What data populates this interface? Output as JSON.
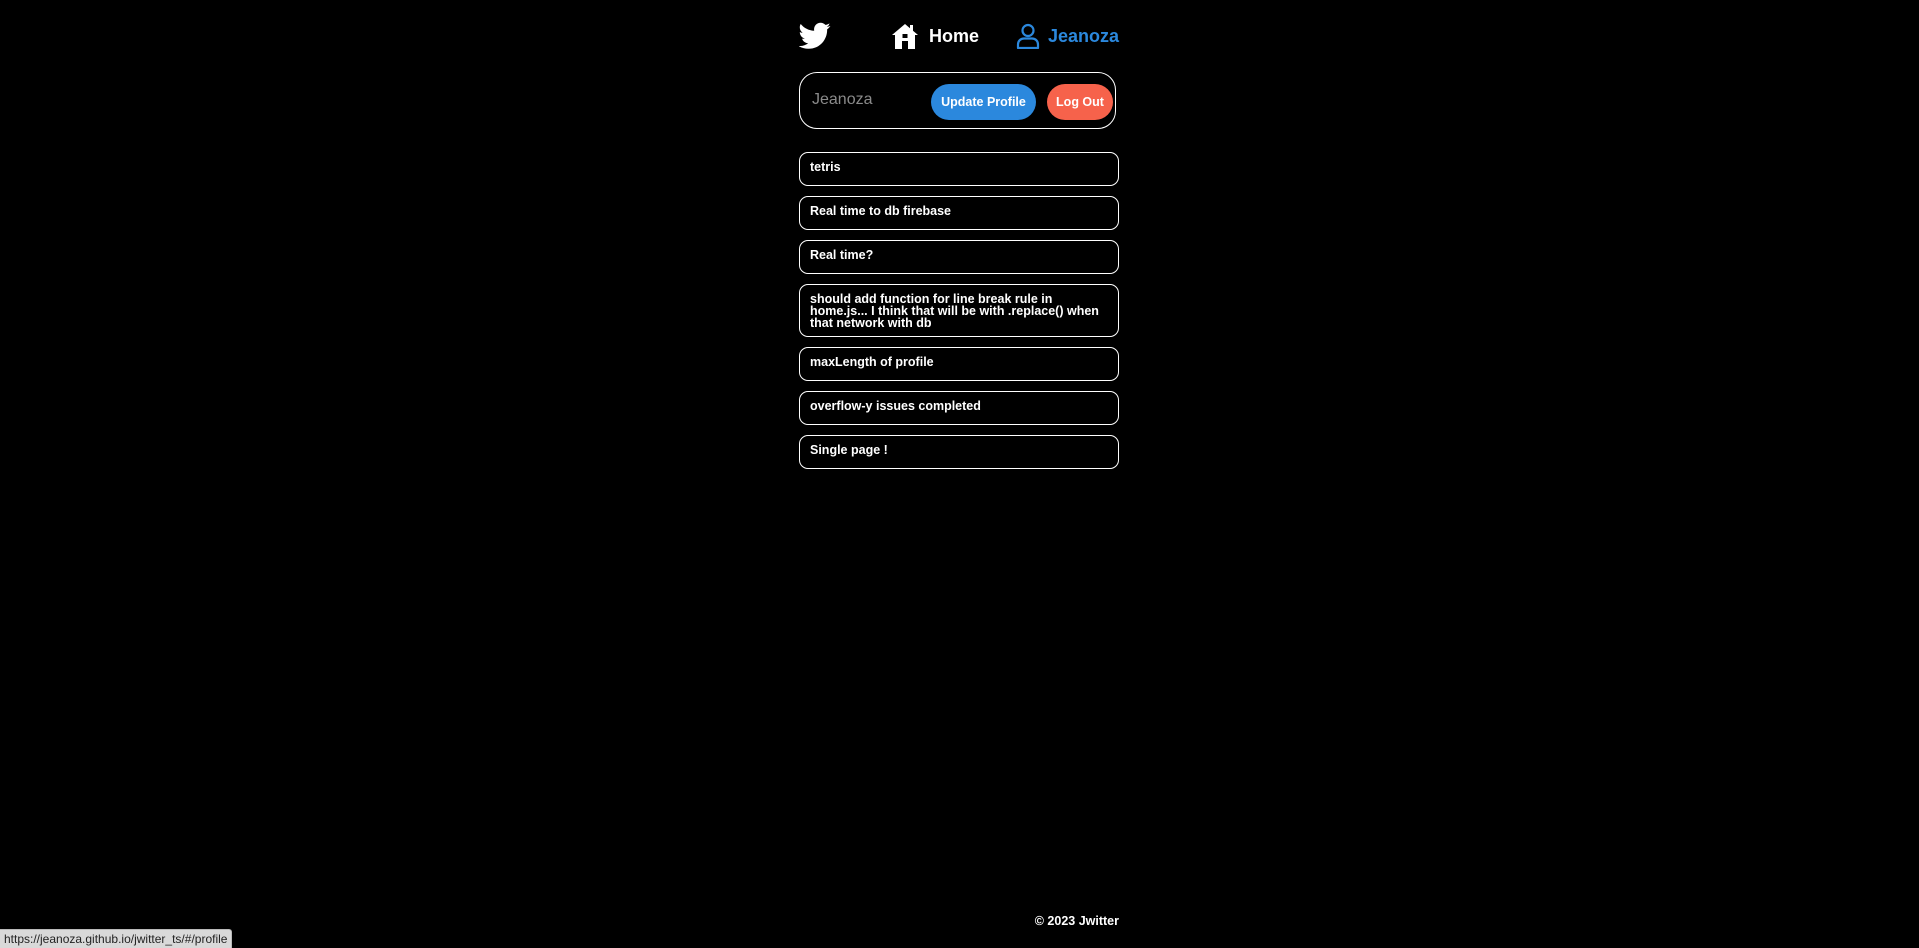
{
  "nav": {
    "logo_icon": "twitter-bird-icon",
    "home_icon": "house-icon",
    "home_label": "Home",
    "profile_icon": "user-icon",
    "profile_label": "Jeanoza"
  },
  "profile_form": {
    "name_placeholder": "Jeanoza",
    "update_label": "Update Profile",
    "logout_label": "Log Out"
  },
  "tweets": [
    {
      "text": "tetris"
    },
    {
      "text": "Real time to db firebase"
    },
    {
      "text": "Real time?"
    },
    {
      "text": "should add function for line break rule in home.js... I think that will be with .replace() when that network with db"
    },
    {
      "text": "maxLength of profile"
    },
    {
      "text": "overflow-y issues completed"
    },
    {
      "text": "Single page !"
    }
  ],
  "footer": {
    "copyright": "© 2023 Jwitter"
  },
  "status_bar": {
    "url": "https://jeanoza.github.io/jwitter_ts/#/profile"
  },
  "colors": {
    "background": "#000000",
    "accent_blue": "#2b88dd",
    "logout_red": "#f6624b",
    "text": "#ffffff"
  }
}
